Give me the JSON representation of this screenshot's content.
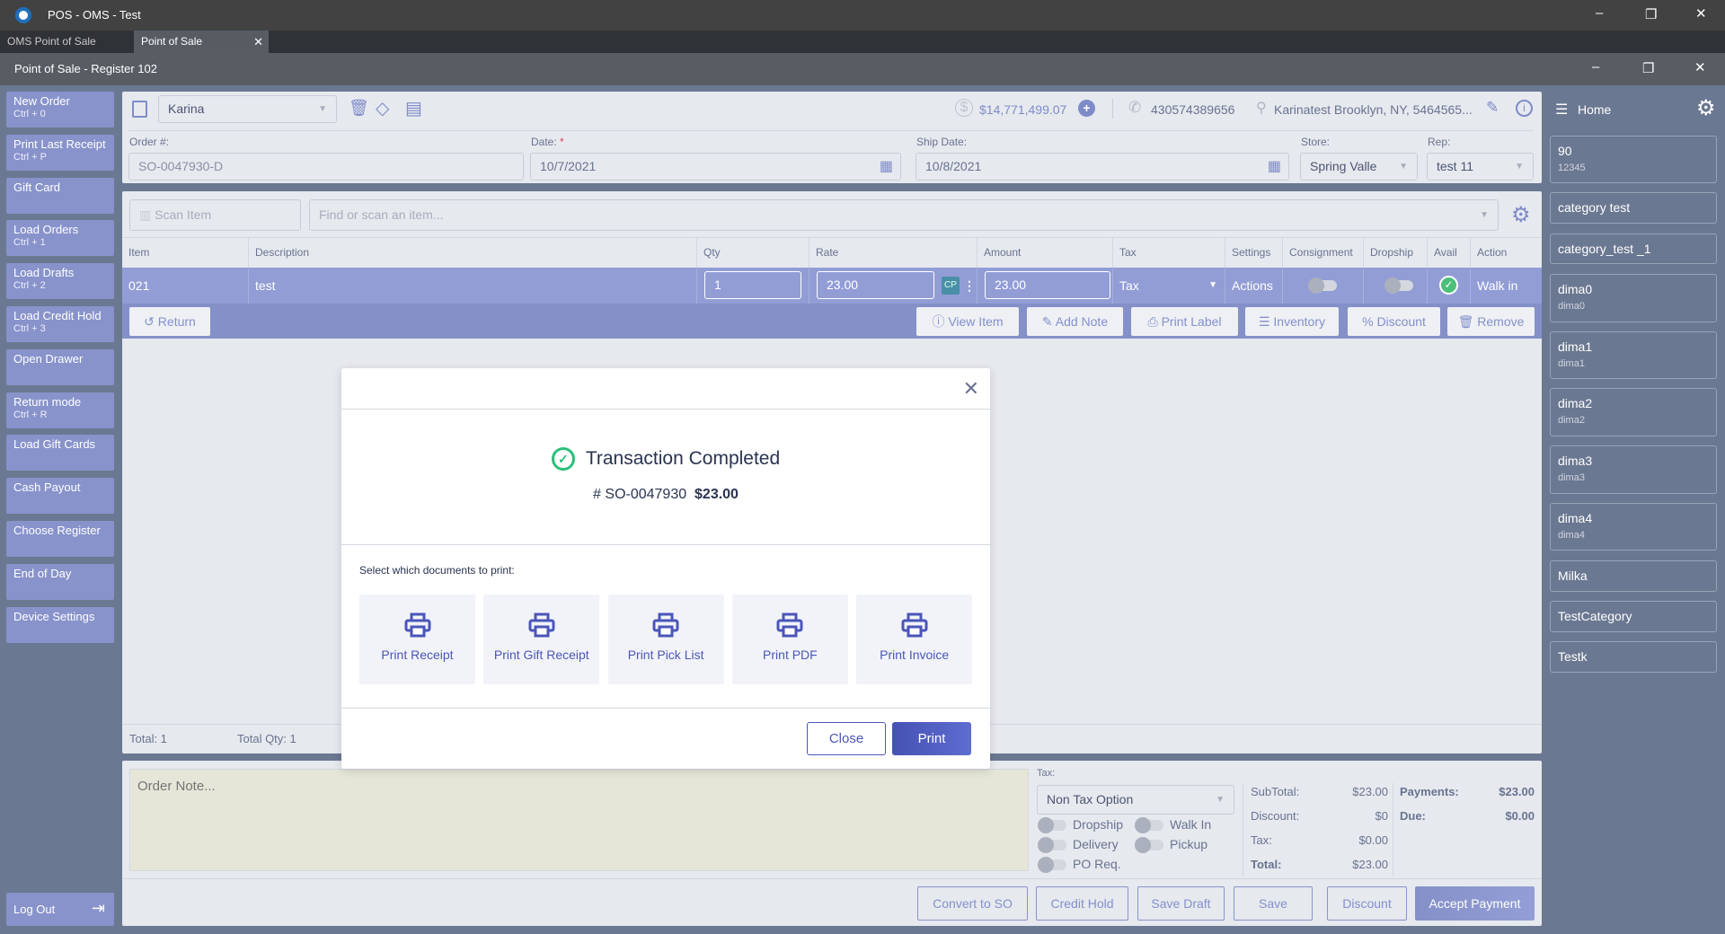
{
  "app": {
    "title": "POS - OMS - Test",
    "tabs": [
      "OMS Point of Sale",
      "Point of Sale"
    ],
    "subtitle": "Point of Sale - Register 102"
  },
  "sidebar": {
    "buttons": [
      {
        "label": "New Order",
        "shortcut": "Ctrl + 0"
      },
      {
        "label": "Print Last Receipt",
        "shortcut": "Ctrl + P"
      },
      {
        "label": "Gift Card",
        "shortcut": ""
      },
      {
        "label": "Load Orders",
        "shortcut": "Ctrl + 1"
      },
      {
        "label": "Load Drafts",
        "shortcut": "Ctrl + 2"
      },
      {
        "label": "Load Credit Hold",
        "shortcut": "Ctrl + 3"
      },
      {
        "label": "Open Drawer",
        "shortcut": ""
      },
      {
        "label": "Return mode",
        "shortcut": "Ctrl + R"
      },
      {
        "label": "Load Gift Cards",
        "shortcut": ""
      },
      {
        "label": "Cash Payout",
        "shortcut": ""
      },
      {
        "label": "Choose Register",
        "shortcut": ""
      },
      {
        "label": "End of Day",
        "shortcut": ""
      },
      {
        "label": "Device Settings",
        "shortcut": ""
      }
    ],
    "logout": "Log Out"
  },
  "customer": {
    "name": "Karina",
    "balance": "$14,771,499.07",
    "phone": "430574389656",
    "address": "Karinatest Brooklyn, NY, 5464565..."
  },
  "order": {
    "order_label": "Order #:",
    "order_value": "SO-0047930-D",
    "date_label": "Date:",
    "required": "*",
    "date_value": "10/7/2021",
    "ship_label": "Ship Date:",
    "ship_value": "10/8/2021",
    "store_label": "Store:",
    "store_value": "Spring Valle",
    "rep_label": "Rep:",
    "rep_value": "test 11"
  },
  "search": {
    "scan_placeholder": "Scan Item",
    "find_placeholder": "Find or scan an item..."
  },
  "table": {
    "headers": [
      "Item",
      "Description",
      "Qty",
      "Rate",
      "Amount",
      "Tax",
      "Settings",
      "Consignment",
      "Dropship",
      "Avail",
      "Action"
    ],
    "row": {
      "item": "021",
      "description": "test",
      "qty": "1",
      "rate": "23.00",
      "cp": "CP",
      "amount": "23.00",
      "tax": "Tax",
      "settings": "Actions",
      "action": "Walk in"
    }
  },
  "row_actions": {
    "return": "Return",
    "view": "View Item",
    "note": "Add Note",
    "label": "Print Label",
    "inventory": "Inventory",
    "discount": "Discount",
    "remove": "Remove"
  },
  "totals_bar": {
    "total": "Total: 1",
    "qty": "Total Qty: 1"
  },
  "bottom": {
    "note_placeholder": "Order Note...",
    "tax_label": "Tax:",
    "tax_value": "Non Tax Option",
    "toggles": [
      "Dropship",
      "Walk In",
      "Delivery",
      "Pickup",
      "PO Req."
    ],
    "subtotal_label": "SubTotal:",
    "subtotal": "$23.00",
    "discount_label": "Discount:",
    "discount": "$0",
    "tax_amt_label": "Tax:",
    "tax_amt": "$0.00",
    "total_label": "Total:",
    "total": "$23.00",
    "payments_label": "Payments:",
    "payments": "$23.00",
    "due_label": "Due:",
    "due": "$0.00",
    "buttons": [
      "Convert to SO",
      "Credit Hold",
      "Save Draft",
      "Save",
      "Discount",
      "Accept Payment"
    ]
  },
  "right": {
    "home": "Home",
    "categories": [
      {
        "name": "90",
        "sub": "12345"
      },
      {
        "name": "category test",
        "sub": ""
      },
      {
        "name": "category_test _1",
        "sub": ""
      },
      {
        "name": "dima0",
        "sub": "dima0"
      },
      {
        "name": "dima1",
        "sub": "dima1"
      },
      {
        "name": "dima2",
        "sub": "dima2"
      },
      {
        "name": "dima3",
        "sub": "dima3"
      },
      {
        "name": "dima4",
        "sub": "dima4"
      },
      {
        "name": "Milka",
        "sub": ""
      },
      {
        "name": "TestCategory",
        "sub": ""
      },
      {
        "name": "Testk",
        "sub": ""
      }
    ]
  },
  "modal": {
    "title": "Transaction Completed",
    "order": "# SO-0047930",
    "amount": "$23.00",
    "prompt": "Select which documents to print:",
    "docs": [
      "Print Receipt",
      "Print Gift Receipt",
      "Print Pick List",
      "Print PDF",
      "Print Invoice"
    ],
    "close": "Close",
    "print": "Print"
  },
  "colors": {
    "accent": "#4a56b8",
    "row": "#929dd6",
    "success": "#2bbf7a"
  }
}
